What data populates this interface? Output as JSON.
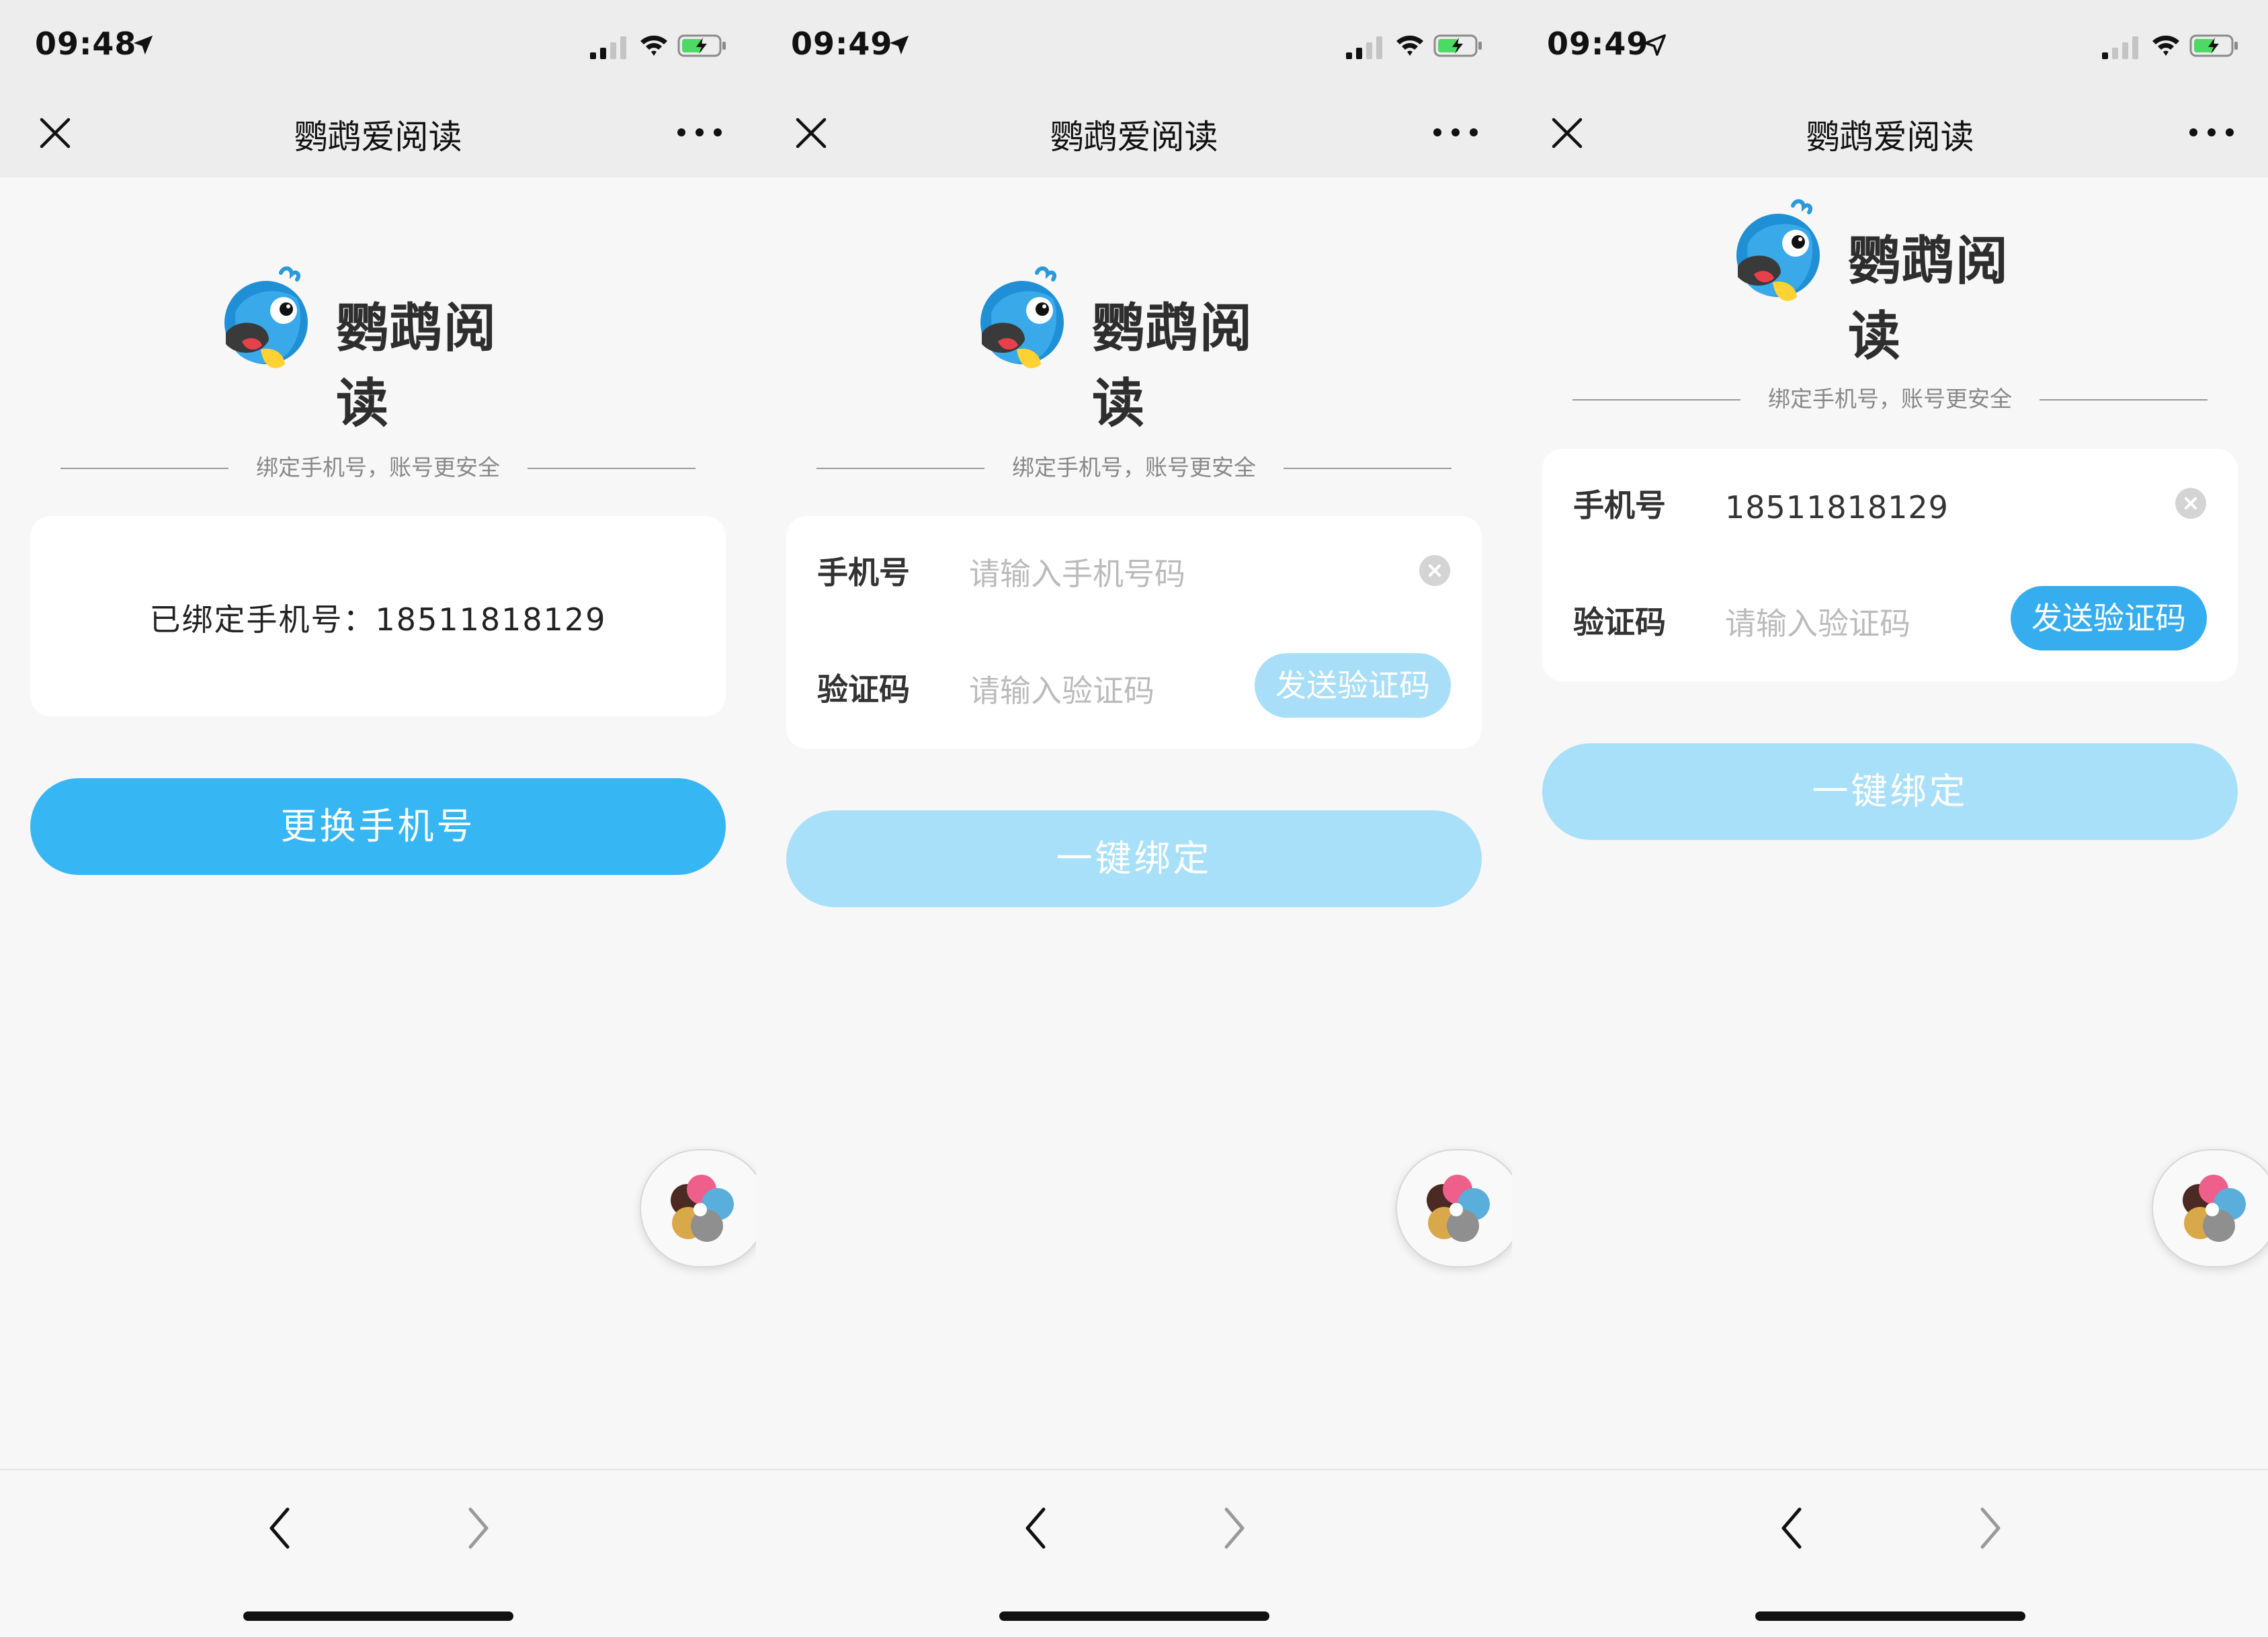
{
  "app_title": "鹦鹉爱阅读",
  "logo_text": "鹦鹉阅读",
  "divider_text": "绑定手机号，账号更安全",
  "screens": [
    {
      "time": "09:48",
      "bound_text": "已绑定手机号：18511818129",
      "primary_button": "更换手机号"
    },
    {
      "time": "09:49",
      "phone_label": "手机号",
      "phone_placeholder": "请输入手机号码",
      "code_label": "验证码",
      "code_placeholder": "请输入验证码",
      "send_code": "发送验证码",
      "bind_button": "一键绑定"
    },
    {
      "time": "09:49",
      "phone_label": "手机号",
      "phone_value": "18511818129",
      "code_label": "验证码",
      "code_placeholder": "请输入验证码",
      "send_code": "发送验证码",
      "bind_button": "一键绑定"
    }
  ],
  "colors": {
    "primary": "#36b6f3",
    "primary_disabled": "#a8e0f9",
    "nav_background": "#ededed",
    "page_background": "#f7f7f7"
  },
  "icons": [
    "location-arrow-icon",
    "signal-icon",
    "wifi-icon",
    "battery-charging-icon",
    "close-icon",
    "more-icon",
    "parrot-logo",
    "clear-icon",
    "mini-program-float-icon",
    "back-arrow-icon",
    "forward-arrow-icon"
  ]
}
